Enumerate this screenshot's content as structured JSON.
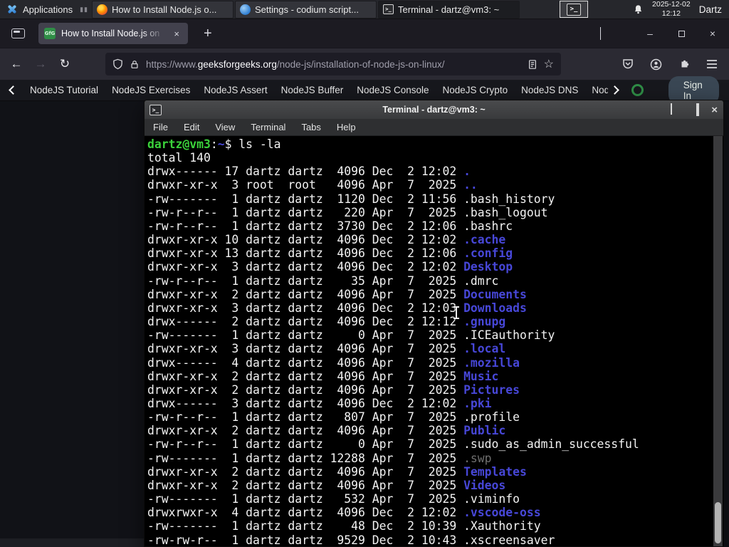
{
  "colors": {
    "gfg_green": "#2f8d46",
    "prompt_green": "#3bd23b",
    "dir_blue": "#4747d8",
    "dim_gray": "#6f6f6f"
  },
  "panel": {
    "applications_label": "Applications",
    "windows": [
      {
        "label": "How to Install Node.js o..."
      },
      {
        "label": "Settings - codium script..."
      },
      {
        "label": "Terminal - dartz@vm3: ~"
      }
    ],
    "clock": {
      "date": "2025-12-02",
      "time": "12:12"
    },
    "user": "Dartz"
  },
  "browser": {
    "tab_title": "How to Install Node.js on",
    "close_tab_label": "×",
    "new_tab_label": "+",
    "minimize_label": "–",
    "close_label": "×",
    "back_label": "←",
    "forward_label": "→",
    "reload_label": "↻",
    "star_label": "☆",
    "url_prefix": "https://www.",
    "url_domain": "geeksforgeeks.org",
    "url_path": "/node-js/installation-of-node-js-on-linux/",
    "favicon_text": "GfG",
    "nav_items": [
      "NodeJS Tutorial",
      "NodeJS Exercises",
      "NodeJS Assert",
      "NodeJS Buffer",
      "NodeJS Console",
      "NodeJS Crypto",
      "NodeJS DNS",
      "Node"
    ],
    "sign_in_label": "Sign In"
  },
  "terminal": {
    "title": "Terminal - dartz@vm3: ~",
    "icon_glyph": ">_",
    "shade_label": "^",
    "close_label": "×",
    "menu": [
      "File",
      "Edit",
      "View",
      "Terminal",
      "Tabs",
      "Help"
    ],
    "lines": [
      [
        {
          "t": "dartz@vm3",
          "c": "g"
        },
        {
          "t": ":",
          "c": "w"
        },
        {
          "t": "~",
          "c": "b"
        },
        {
          "t": "$ ls -la",
          "c": "w"
        }
      ],
      [
        {
          "t": "total 140",
          "c": "w"
        }
      ],
      [
        {
          "t": "drwx------ 17 dartz dartz  4096 Dec  2 12:02 ",
          "c": "w"
        },
        {
          "t": ".",
          "c": "b"
        }
      ],
      [
        {
          "t": "drwxr-xr-x  3 root  root   4096 Apr  7  2025 ",
          "c": "w"
        },
        {
          "t": "..",
          "c": "b"
        }
      ],
      [
        {
          "t": "-rw-------  1 dartz dartz  1120 Dec  2 11:56 .bash_history",
          "c": "w"
        }
      ],
      [
        {
          "t": "-rw-r--r--  1 dartz dartz   220 Apr  7  2025 .bash_logout",
          "c": "w"
        }
      ],
      [
        {
          "t": "-rw-r--r--  1 dartz dartz  3730 Dec  2 12:06 .bashrc",
          "c": "w"
        }
      ],
      [
        {
          "t": "drwxr-xr-x 10 dartz dartz  4096 Dec  2 12:02 ",
          "c": "w"
        },
        {
          "t": ".cache",
          "c": "b"
        }
      ],
      [
        {
          "t": "drwxr-xr-x 13 dartz dartz  4096 Dec  2 12:06 ",
          "c": "w"
        },
        {
          "t": ".config",
          "c": "b"
        }
      ],
      [
        {
          "t": "drwxr-xr-x  3 dartz dartz  4096 Dec  2 12:02 ",
          "c": "w"
        },
        {
          "t": "Desktop",
          "c": "b"
        }
      ],
      [
        {
          "t": "-rw-r--r--  1 dartz dartz    35 Apr  7  2025 .dmrc",
          "c": "w"
        }
      ],
      [
        {
          "t": "drwxr-xr-x  2 dartz dartz  4096 Apr  7  2025 ",
          "c": "w"
        },
        {
          "t": "Documents",
          "c": "b"
        }
      ],
      [
        {
          "t": "drwxr-xr-x  3 dartz dartz  4096 Dec  2 12:03 ",
          "c": "w"
        },
        {
          "t": "Downloads",
          "c": "b"
        }
      ],
      [
        {
          "t": "drwx------  2 dartz dartz  4096 Dec  2 12:12 ",
          "c": "w"
        },
        {
          "t": ".gnupg",
          "c": "b"
        }
      ],
      [
        {
          "t": "-rw-------  1 dartz dartz     0 Apr  7  2025 .ICEauthority",
          "c": "w"
        }
      ],
      [
        {
          "t": "drwxr-xr-x  3 dartz dartz  4096 Apr  7  2025 ",
          "c": "w"
        },
        {
          "t": ".local",
          "c": "b"
        }
      ],
      [
        {
          "t": "drwx------  4 dartz dartz  4096 Apr  7  2025 ",
          "c": "w"
        },
        {
          "t": ".mozilla",
          "c": "b"
        }
      ],
      [
        {
          "t": "drwxr-xr-x  2 dartz dartz  4096 Apr  7  2025 ",
          "c": "w"
        },
        {
          "t": "Music",
          "c": "b"
        }
      ],
      [
        {
          "t": "drwxr-xr-x  2 dartz dartz  4096 Apr  7  2025 ",
          "c": "w"
        },
        {
          "t": "Pictures",
          "c": "b"
        }
      ],
      [
        {
          "t": "drwx------  3 dartz dartz  4096 Dec  2 12:02 ",
          "c": "w"
        },
        {
          "t": ".pki",
          "c": "b"
        }
      ],
      [
        {
          "t": "-rw-r--r--  1 dartz dartz   807 Apr  7  2025 .profile",
          "c": "w"
        }
      ],
      [
        {
          "t": "drwxr-xr-x  2 dartz dartz  4096 Apr  7  2025 ",
          "c": "w"
        },
        {
          "t": "Public",
          "c": "b"
        }
      ],
      [
        {
          "t": "-rw-r--r--  1 dartz dartz     0 Apr  7  2025 .sudo_as_admin_successful",
          "c": "w"
        }
      ],
      [
        {
          "t": "-rw-------  1 dartz dartz 12288 Apr  7  2025 ",
          "c": "w"
        },
        {
          "t": ".swp",
          "c": "d"
        }
      ],
      [
        {
          "t": "drwxr-xr-x  2 dartz dartz  4096 Apr  7  2025 ",
          "c": "w"
        },
        {
          "t": "Templates",
          "c": "b"
        }
      ],
      [
        {
          "t": "drwxr-xr-x  2 dartz dartz  4096 Apr  7  2025 ",
          "c": "w"
        },
        {
          "t": "Videos",
          "c": "b"
        }
      ],
      [
        {
          "t": "-rw-------  1 dartz dartz   532 Apr  7  2025 .viminfo",
          "c": "w"
        }
      ],
      [
        {
          "t": "drwxrwxr-x  4 dartz dartz  4096 Dec  2 12:02 ",
          "c": "w"
        },
        {
          "t": ".vscode-oss",
          "c": "b"
        }
      ],
      [
        {
          "t": "-rw-------  1 dartz dartz    48 Dec  2 10:39 .Xauthority",
          "c": "w"
        }
      ],
      [
        {
          "t": "-rw-rw-r--  1 dartz dartz  9529 Dec  2 10:43 .xscreensaver",
          "c": "w"
        }
      ]
    ]
  }
}
